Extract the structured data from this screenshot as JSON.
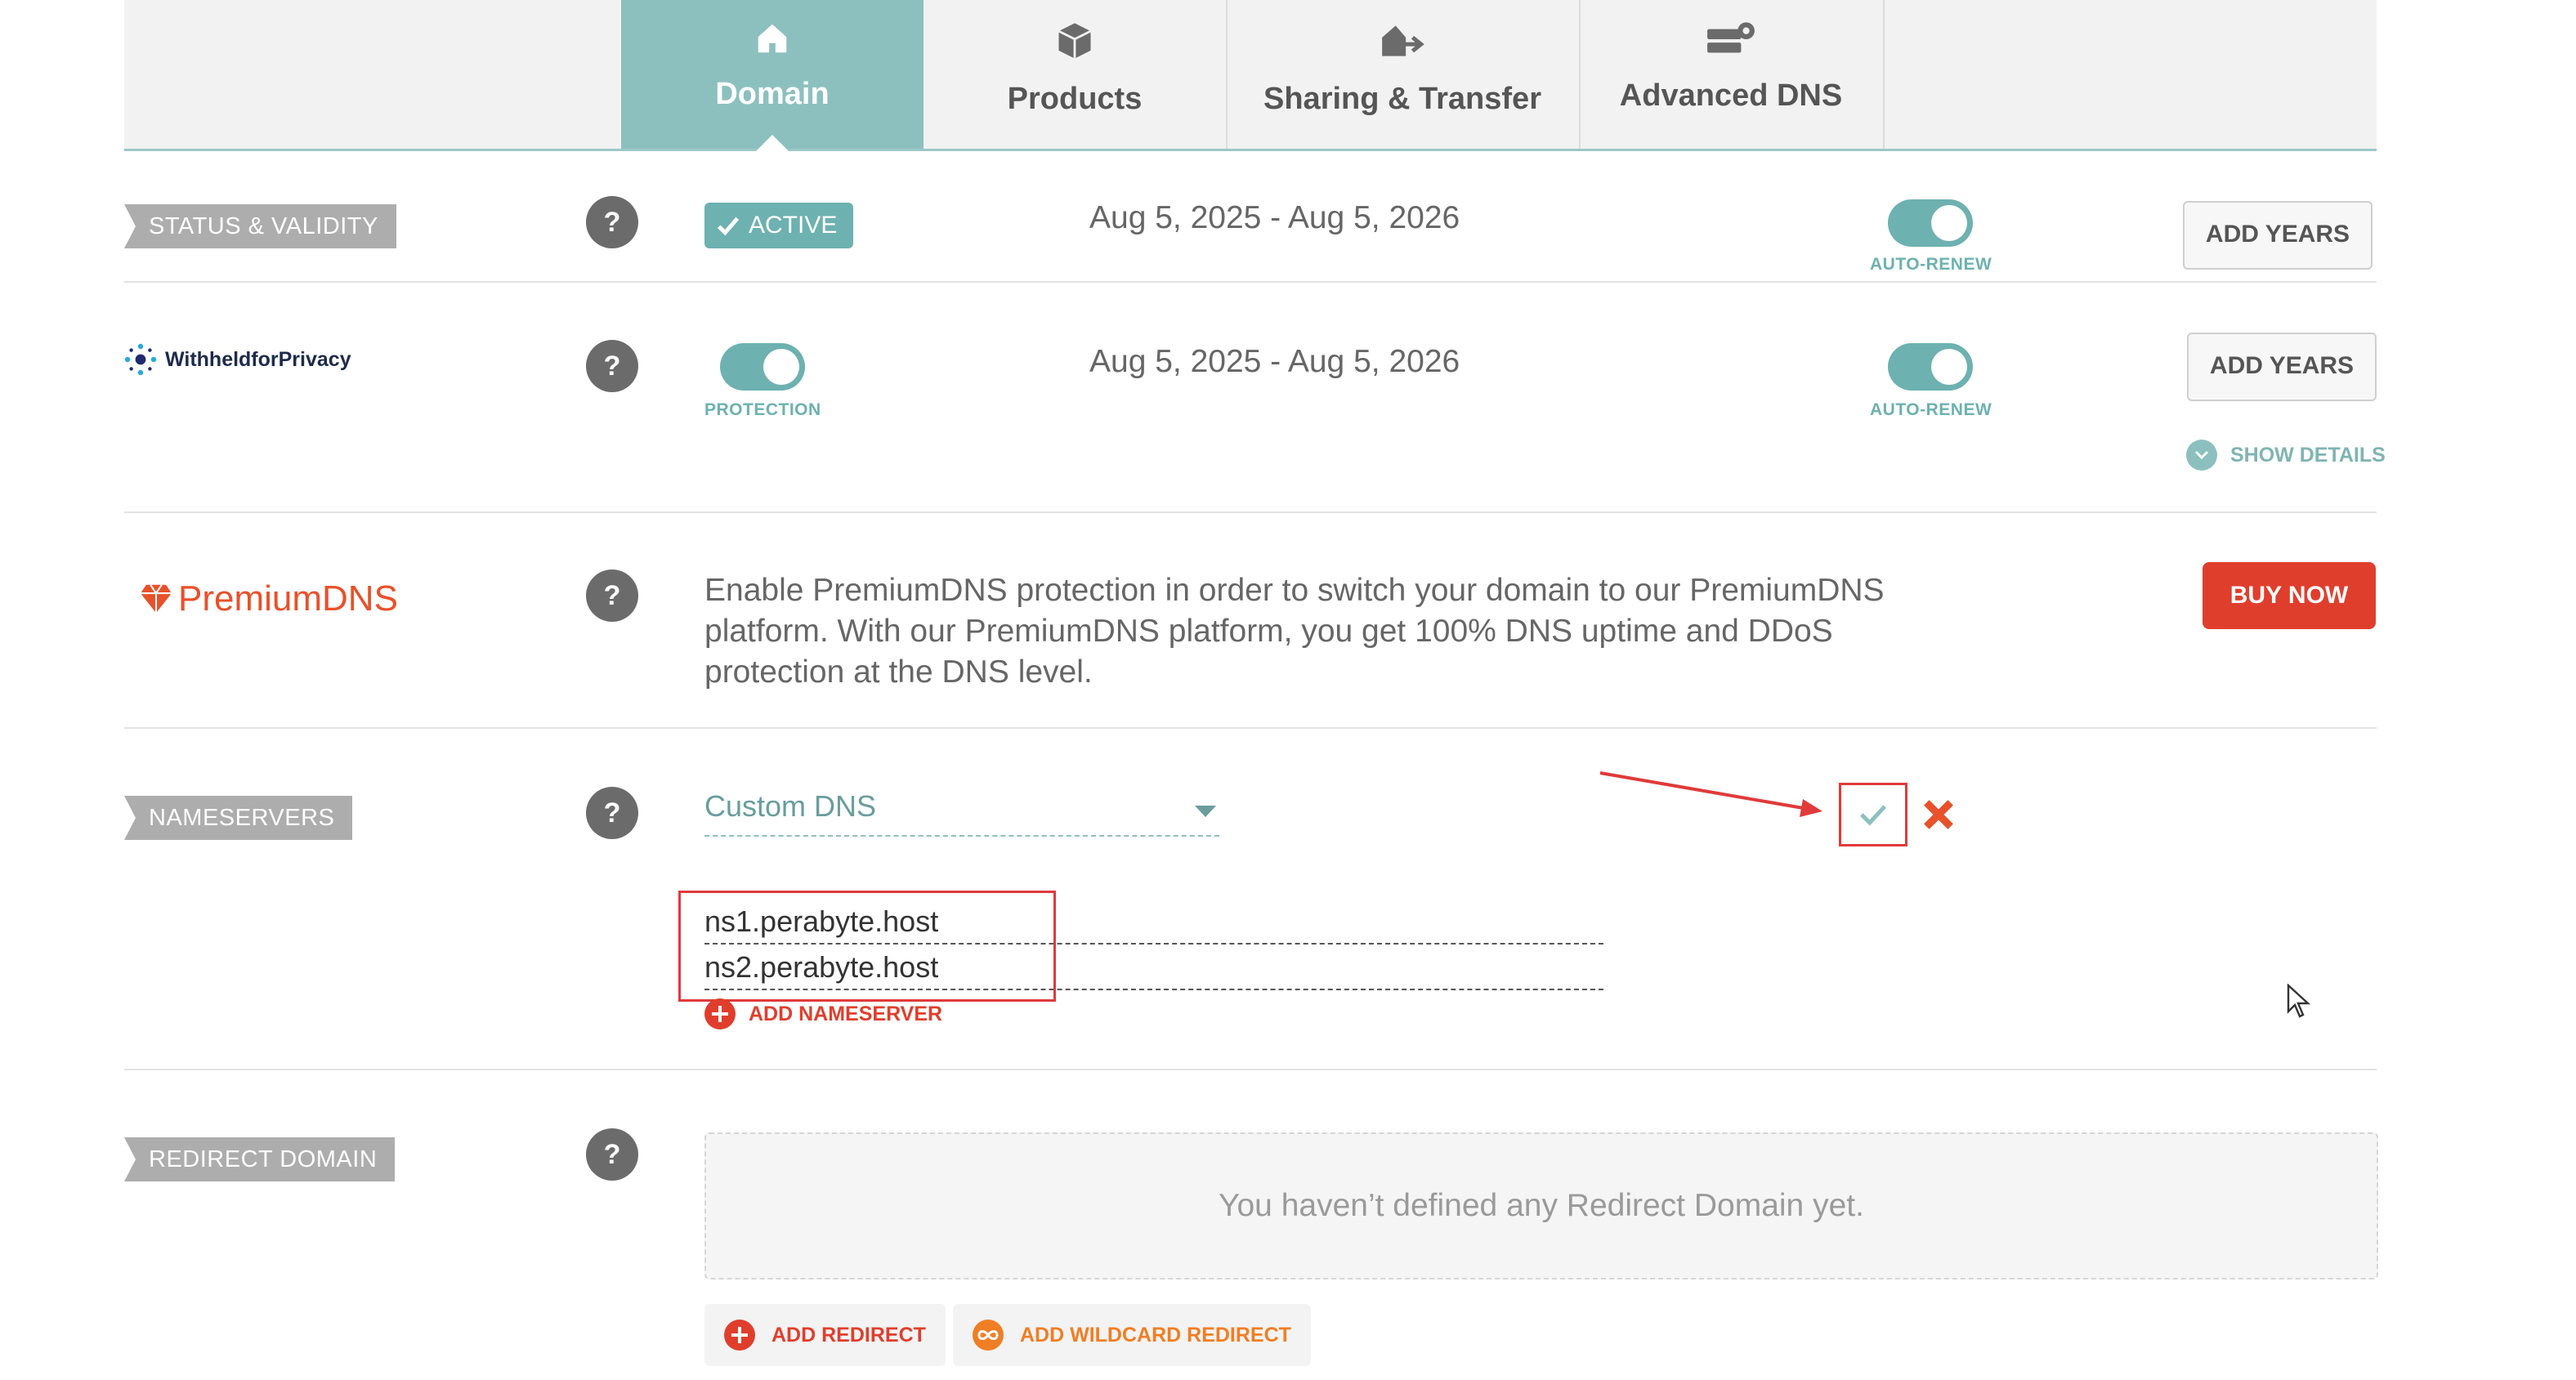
{
  "tabs": [
    {
      "label": "Domain",
      "icon": "home-icon",
      "active": true
    },
    {
      "label": "Products",
      "icon": "box-icon",
      "active": false
    },
    {
      "label": "Sharing & Transfer",
      "icon": "house-transfer-icon",
      "active": false
    },
    {
      "label": "Advanced DNS",
      "icon": "server-gear-icon",
      "active": false
    }
  ],
  "help_label": "?",
  "status": {
    "tag": "STATUS & VALIDITY",
    "badge": "ACTIVE",
    "dates": "Aug 5, 2025 - Aug 5, 2026",
    "autorenew_label": "AUTO-RENEW",
    "button": "ADD YEARS"
  },
  "privacy": {
    "logo_text": "WithheldforPrivacy",
    "protection_label": "PROTECTION",
    "dates": "Aug 5, 2025 - Aug 5, 2026",
    "autorenew_label": "AUTO-RENEW",
    "button": "ADD YEARS",
    "show_details": "SHOW DETAILS"
  },
  "premium": {
    "logo_text": "PremiumDNS",
    "description": "Enable PremiumDNS protection in order to switch your domain to our PremiumDNS platform. With our PremiumDNS platform, you get 100% DNS uptime and DDoS protection at the DNS level.",
    "button": "BUY NOW"
  },
  "nameservers": {
    "tag": "NAMESERVERS",
    "selected": "Custom DNS",
    "entries": [
      "ns1.perabyte.host",
      "ns2.perabyte.host"
    ],
    "add_label": "ADD NAMESERVER"
  },
  "redirect": {
    "tag": "REDIRECT DOMAIN",
    "empty_text": "You haven’t defined any Redirect Domain yet.",
    "add_redirect": "ADD REDIRECT",
    "add_wildcard": "ADD WILDCARD REDIRECT"
  },
  "colors": {
    "teal": "#8cc0bf",
    "accent_red": "#e03e2d",
    "orange": "#f07e24",
    "annotation_red": "#e03a3a"
  }
}
